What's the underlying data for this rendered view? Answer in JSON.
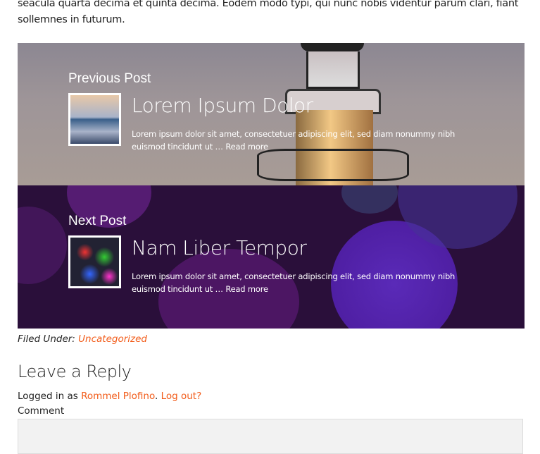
{
  "intro_text": "seacula quarta decima et quinta decima. Eodem modo typi, qui nunc nobis videntur parum clari, fiant sollemnes in futurum.",
  "post_nav": {
    "previous": {
      "heading": "Previous Post",
      "title": "Lorem Ipsum Dolor",
      "excerpt": "Lorem ipsum dolor sit amet, consectetuer adipiscing elit, sed diam nonummy nibh euismod tincidunt ut … ",
      "read_more": "Read more"
    },
    "next": {
      "heading": "Next Post",
      "title": "Nam Liber Tempor",
      "excerpt": "Lorem ipsum dolor sit amet, consectetuer adipiscing elit, sed diam nonummy nibh euismod tincidunt ut … ",
      "read_more": "Read more"
    }
  },
  "filed_under": {
    "label": "Filed Under:",
    "category": "Uncategorized"
  },
  "comments": {
    "heading": "Leave a Reply",
    "logged_in_prefix": "Logged in as",
    "user": "Rommel Plofino",
    "logout": "Log out?",
    "comment_label": "Comment",
    "comment_value": ""
  },
  "colors": {
    "link": "#f25c1a"
  }
}
